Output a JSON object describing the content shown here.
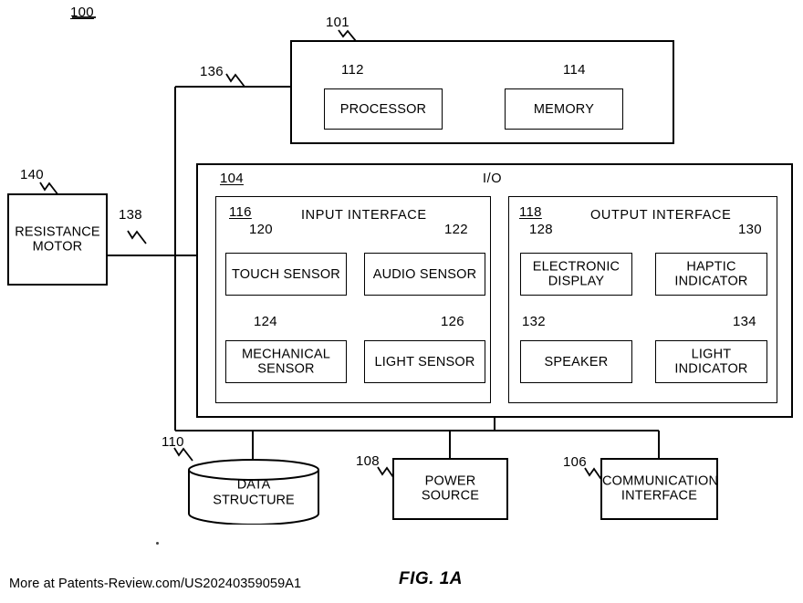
{
  "figure": {
    "caption": "FIG. 1A",
    "system_ref": "100",
    "footer_url": "More at Patents-Review.com/US20240359059A1"
  },
  "computing_device": {
    "ref": "101",
    "blocks": [
      {
        "ref": "112",
        "label": "PROCESSOR"
      },
      {
        "ref": "114",
        "label": "MEMORY"
      }
    ]
  },
  "io": {
    "ref": "104",
    "title": "I/O",
    "input_interface": {
      "ref": "116",
      "title": "INPUT INTERFACE",
      "blocks": [
        {
          "ref": "120",
          "label": "TOUCH SENSOR"
        },
        {
          "ref": "122",
          "label": "AUDIO SENSOR"
        },
        {
          "ref": "124",
          "label": "MECHANICAL\nSENSOR",
          "line1": "MECHANICAL",
          "line2": "SENSOR"
        },
        {
          "ref": "126",
          "label": "LIGHT SENSOR"
        }
      ]
    },
    "output_interface": {
      "ref": "118",
      "title": "OUTPUT INTERFACE",
      "blocks": [
        {
          "ref": "128",
          "line1": "ELECTRONIC",
          "line2": "DISPLAY"
        },
        {
          "ref": "130",
          "line1": "HAPTIC",
          "line2": "INDICATOR"
        },
        {
          "ref": "132",
          "line1": "SPEAKER",
          "line2": ""
        },
        {
          "ref": "134",
          "line1": "LIGHT",
          "line2": "INDICATOR"
        }
      ]
    }
  },
  "peripherals": {
    "resistance_motor": {
      "ref": "140",
      "line1": "RESISTANCE",
      "line2": "MOTOR"
    },
    "data_structure": {
      "ref": "110",
      "line1": "DATA",
      "line2": "STRUCTURE"
    },
    "power_source": {
      "ref": "108",
      "line1": "POWER SOURCE",
      "line2": ""
    },
    "communication_interface": {
      "ref": "106",
      "line1": "COMMUNICATION",
      "line2": "INTERFACE"
    }
  },
  "connectors": {
    "bus_to_computing_device": "136",
    "motor_link": "138"
  },
  "colors": {
    "line": "#000000",
    "background": "#ffffff"
  }
}
